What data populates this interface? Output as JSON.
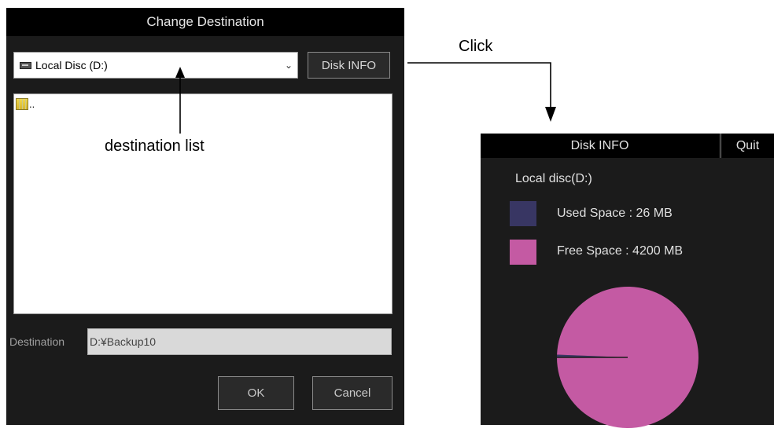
{
  "dialog": {
    "title": "Change Destination",
    "drive_select": {
      "value": "Local Disc (D:)",
      "icon": "drive-icon"
    },
    "disk_info_button": "Disk INFO",
    "file_list": {
      "items": [
        {
          "label": "..",
          "icon": "parent-folder-icon"
        }
      ]
    },
    "destination": {
      "label": "Destination",
      "value": "D:¥Backup10"
    },
    "ok_button": "OK",
    "cancel_button": "Cancel"
  },
  "annotations": {
    "destination_list": "destination list",
    "click": "Click"
  },
  "disk_info": {
    "title": "Disk INFO",
    "quit_button": "Quit",
    "disk_name": "Local disc(D:)",
    "used_label": "Used Space : 26 MB",
    "free_label": "Free Space : 4200 MB"
  },
  "chart_data": {
    "type": "pie",
    "title": "",
    "slices": [
      {
        "name": "Used Space",
        "value": 26,
        "color": "#383663"
      },
      {
        "name": "Free Space",
        "value": 4200,
        "color": "#c45aa3"
      }
    ]
  },
  "colors": {
    "used": "#383663",
    "free": "#c45aa3",
    "dialog_bg": "#1b1b1b",
    "title_bg": "#000000"
  }
}
